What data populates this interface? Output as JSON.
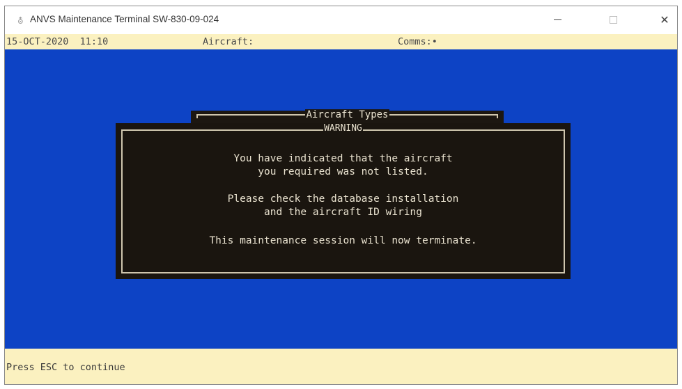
{
  "window": {
    "title": "ANVS Maintenance Terminal SW-830-09-024",
    "icon": "app-icon",
    "controls": {
      "minimize": "—",
      "close": "✕"
    }
  },
  "status_bar": {
    "datetime": "15-OCT-2020  11:10",
    "aircraft_label": "Aircraft:",
    "comms_label": "Comms:•"
  },
  "dialogs": {
    "aircraft_types": {
      "title": "Aircraft Types"
    },
    "warning": {
      "title": "WARNING",
      "messages": [
        "You have indicated that the aircraft",
        "you required was not listed.",
        "Please check the database installation",
        "and the aircraft ID wiring",
        "This maintenance session will now terminate."
      ]
    }
  },
  "footer": {
    "prompt": "Press ESC to continue"
  },
  "colors": {
    "terminal_background": "#0d43c5",
    "status_background": "#fbf1c0",
    "dialog_background": "#1a150f",
    "dialog_text": "#e9e2cf"
  }
}
